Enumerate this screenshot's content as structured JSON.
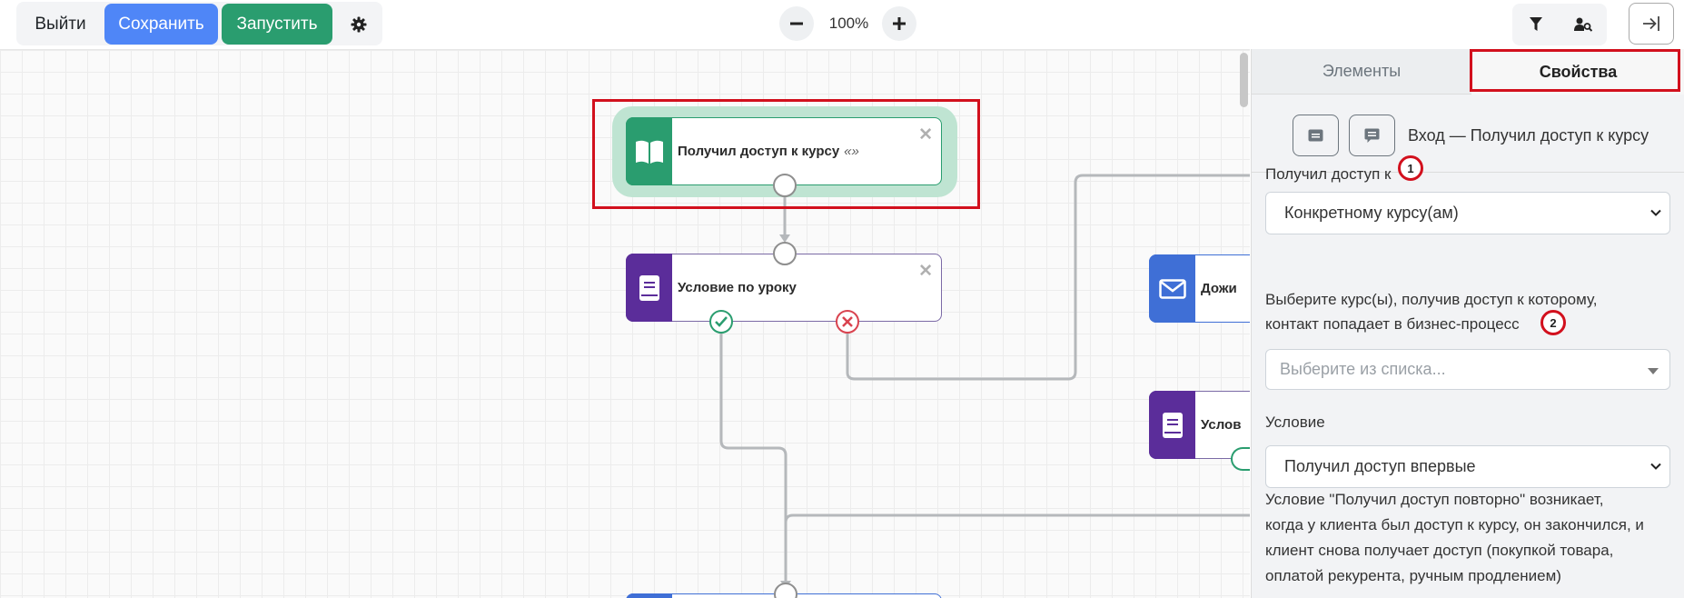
{
  "toolbar": {
    "exit_label": "Выйти",
    "save_label": "Сохранить",
    "run_label": "Запустить",
    "zoom_level": "100%"
  },
  "nodes": {
    "entry": {
      "title": "Получил доступ к курсу",
      "quote": "«»",
      "color": "#2a9d6f"
    },
    "lesson_condition": {
      "title": "Условие по уроку",
      "color": "#5b2d9a"
    },
    "wait": {
      "title": "Дожи",
      "color": "#3f6fd6"
    },
    "condition2": {
      "title": "Услов",
      "color": "#5b2d9a"
    }
  },
  "panel": {
    "tabs": {
      "elements": "Элементы",
      "properties": "Свойства"
    },
    "header_title": "Вход — Получил доступ к курсу",
    "access_label": "Получил доступ к",
    "access_value": "Конкретному курсу(ам)",
    "courses_label_line1": "Выберите курс(ы), получив доступ к которому,",
    "courses_label_line2": "контакт попадает в бизнес-процесс",
    "courses_placeholder": "Выберите из списка...",
    "condition_label": "Условие",
    "condition_value": "Получил доступ впервые",
    "help_line1": "Условие \"Получил доступ повторно\" возникает,",
    "help_line2": "когда у клиента был доступ к курсу, он закончился, и",
    "help_line3": "клиент снова получает доступ (покупкой товара,",
    "help_line4": "оплатой рекурента, ручным продлением)"
  },
  "annotations": {
    "badge1": "1",
    "badge2": "2"
  },
  "colors": {
    "save": "#4f86f7",
    "run": "#2a9d6f",
    "highlight": "#d2101d"
  }
}
